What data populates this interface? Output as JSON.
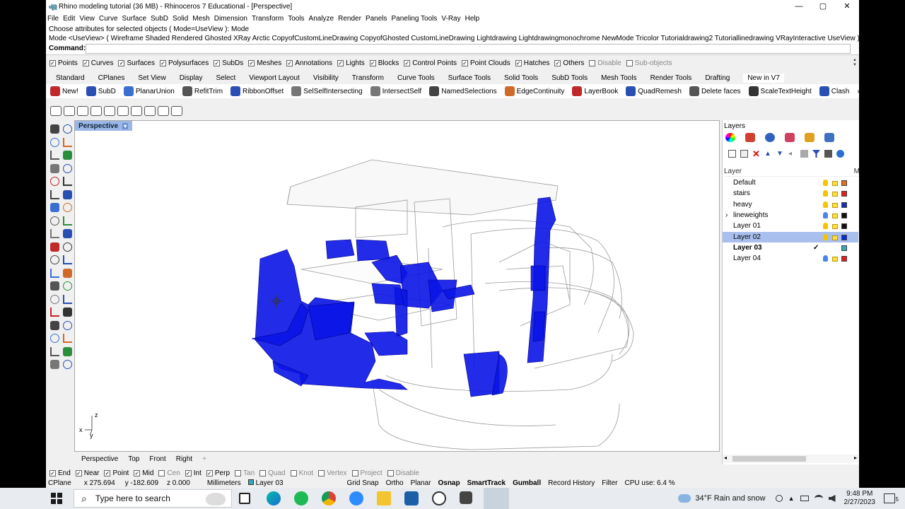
{
  "window": {
    "title": "Rhino modeling tutorial (36 MB) - Rhinoceros 7 Educational - [Perspective]"
  },
  "menu": [
    "File",
    "Edit",
    "View",
    "Curve",
    "Surface",
    "SubD",
    "Solid",
    "Mesh",
    "Dimension",
    "Transform",
    "Tools",
    "Analyze",
    "Render",
    "Panels",
    "Paneling Tools",
    "V-Ray",
    "Help"
  ],
  "command": {
    "line1": "Choose attributes for selected objects ( Mode=UseView ): Mode",
    "line2": "Mode <UseView> ( Wireframe  Shaded  Rendered  Ghosted  XRay  Arctic  CopyofCustomLineDrawing  CopyofGhosted  CustomLineDrawing  Lightdrawing  Lightdrawingmonochrome  NewMode  Tricolor  Tutorialdrawing2  Tutoriallinedrawing  VRayInteractive  UseView ): Gh",
    "prompt": "Command:"
  },
  "filters": [
    {
      "label": "Points",
      "checked": true
    },
    {
      "label": "Curves",
      "checked": true
    },
    {
      "label": "Surfaces",
      "checked": true
    },
    {
      "label": "Polysurfaces",
      "checked": true
    },
    {
      "label": "SubDs",
      "checked": true
    },
    {
      "label": "Meshes",
      "checked": true
    },
    {
      "label": "Annotations",
      "checked": true
    },
    {
      "label": "Lights",
      "checked": true
    },
    {
      "label": "Blocks",
      "checked": true
    },
    {
      "label": "Control Points",
      "checked": true
    },
    {
      "label": "Point Clouds",
      "checked": true
    },
    {
      "label": "Hatches",
      "checked": true
    },
    {
      "label": "Others",
      "checked": true
    },
    {
      "label": "Disable",
      "checked": false
    },
    {
      "label": "Sub-objects",
      "checked": false
    }
  ],
  "tabs": [
    "Standard",
    "CPlanes",
    "Set View",
    "Display",
    "Select",
    "Viewport Layout",
    "Visibility",
    "Transform",
    "Curve Tools",
    "Surface Tools",
    "Solid Tools",
    "SubD Tools",
    "Mesh Tools",
    "Render Tools",
    "Drafting",
    "New in V7"
  ],
  "toolbar": [
    {
      "label": "New!",
      "color": "#c0282a"
    },
    {
      "label": "SubD",
      "color": "#2a4fb3"
    },
    {
      "label": "PlanarUnion",
      "color": "#3a6fd0"
    },
    {
      "label": "RefitTrim",
      "color": "#555"
    },
    {
      "label": "RibbonOffset",
      "color": "#2a4fb3"
    },
    {
      "label": "SelSelfIntersecting",
      "color": "#777"
    },
    {
      "label": "IntersectSelf",
      "color": "#777"
    },
    {
      "label": "NamedSelections",
      "color": "#444"
    },
    {
      "label": "EdgeContinuity",
      "color": "#d06a2a"
    },
    {
      "label": "LayerBook",
      "color": "#c0282a"
    },
    {
      "label": "QuadRemesh",
      "color": "#2a4fb3"
    },
    {
      "label": "Delete faces",
      "color": "#555"
    },
    {
      "label": "ScaleTextHeight",
      "color": "#333"
    },
    {
      "label": "Clash",
      "color": "#2a4fb3"
    }
  ],
  "toolbar_more": "»",
  "viewport": {
    "name": "Perspective",
    "arrow": "▾",
    "axis_x": "x",
    "axis_y": "y",
    "axis_z": "z"
  },
  "view_tabs": [
    "Perspective",
    "Top",
    "Front",
    "Right"
  ],
  "view_tabs_add": "+",
  "layers": {
    "panel_title": "Layers",
    "col_layer": "Layer",
    "col_m": "M",
    "rows": [
      {
        "name": "Default",
        "color": "#e07020",
        "bulb": "#f5c400",
        "current": false,
        "selected": false
      },
      {
        "name": "stairs",
        "color": "#e02020",
        "bulb": "#f5c400",
        "current": false,
        "selected": false
      },
      {
        "name": "heavy",
        "color": "#1a2fb0",
        "bulb": "#f5c400",
        "current": false,
        "selected": false
      },
      {
        "name": "lineweights",
        "color": "#111111",
        "bulb": "#4a86e8",
        "current": false,
        "selected": false,
        "expand": true
      },
      {
        "name": "Layer 01",
        "color": "#111111",
        "bulb": "#f5c400",
        "current": false,
        "selected": false
      },
      {
        "name": "Layer 02",
        "color": "#0a2cd8",
        "bulb": "#f5c400",
        "current": false,
        "selected": true
      },
      {
        "name": "Layer 03",
        "color": "#3aa6b9",
        "bulb": "",
        "current": true,
        "selected": false
      },
      {
        "name": "Layer 04",
        "color": "#e02020",
        "bulb": "#4a86e8",
        "current": false,
        "selected": false
      }
    ],
    "expand_glyph": "›",
    "check_glyph": "✓"
  },
  "osnaps": [
    {
      "label": "End",
      "checked": true
    },
    {
      "label": "Near",
      "checked": true
    },
    {
      "label": "Point",
      "checked": true
    },
    {
      "label": "Mid",
      "checked": true
    },
    {
      "label": "Cen",
      "checked": false
    },
    {
      "label": "Int",
      "checked": true
    },
    {
      "label": "Perp",
      "checked": true
    },
    {
      "label": "Tan",
      "checked": false
    },
    {
      "label": "Quad",
      "checked": false
    },
    {
      "label": "Knot",
      "checked": false
    },
    {
      "label": "Vertex",
      "checked": false
    },
    {
      "label": "Project",
      "checked": false
    },
    {
      "label": "Disable",
      "checked": false
    }
  ],
  "status": {
    "cplane": "CPlane",
    "x": "x 275.694",
    "y": "y -182.609",
    "z": "z 0.000",
    "units": "Millimeters",
    "layer": "Layer 03",
    "grid_snap": "Grid Snap",
    "ortho": "Ortho",
    "planar": "Planar",
    "osnap": "Osnap",
    "smarttrack": "SmartTrack",
    "gumball": "Gumball",
    "history": "Record History",
    "filter": "Filter",
    "cpu": "CPU use: 6.4 %"
  },
  "taskbar": {
    "search_placeholder": "Type here to search",
    "weather": "34°F  Rain and snow",
    "time": "9:48 PM",
    "date": "2/27/2023",
    "notif": "5"
  },
  "window_controls": {
    "min": "—",
    "max": "▢",
    "close": "✕"
  },
  "glyphs": {
    "check": "✓",
    "search": "⌕",
    "up": "▲",
    "down": "▼",
    "left": "◂",
    "right": "▸",
    "plus": "+"
  }
}
